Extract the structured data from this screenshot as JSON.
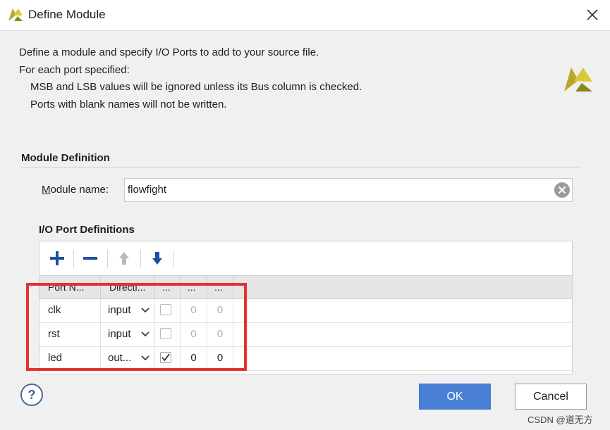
{
  "window": {
    "title": "Define Module"
  },
  "intro": {
    "line1": "Define a module and specify I/O Ports to add to your source file.",
    "line2": "For each port specified:",
    "line3": "MSB and LSB values will be ignored unless its Bus column is checked.",
    "line4": "Ports with blank names will not be written."
  },
  "module_definition": {
    "header": "Module Definition",
    "label_prefix": "M",
    "label_rest": "odule name:",
    "value": "flowfight"
  },
  "io_ports": {
    "header": "I/O Port Definitions",
    "columns": [
      "Port N...",
      "Directi...",
      "...",
      "...",
      "..."
    ],
    "rows": [
      {
        "name": "clk",
        "direction": "input",
        "bus": false,
        "msb": "0",
        "lsb": "0"
      },
      {
        "name": "rst",
        "direction": "input",
        "bus": false,
        "msb": "0",
        "lsb": "0"
      },
      {
        "name": "led",
        "direction": "out...",
        "bus": true,
        "msb": "0",
        "lsb": "0"
      }
    ]
  },
  "buttons": {
    "help": "?",
    "ok": "OK",
    "cancel": "Cancel"
  },
  "watermark": "CSDN @道无方",
  "colors": {
    "accent": "#4a7fd6",
    "highlight": "#e5322d",
    "logo": "#b7a72a"
  },
  "icons": [
    "vivado-logo-icon",
    "close-icon",
    "clear-icon",
    "add-icon",
    "remove-icon",
    "move-up-icon",
    "move-down-icon",
    "chevron-down-icon",
    "checkmark-icon",
    "help-icon"
  ]
}
